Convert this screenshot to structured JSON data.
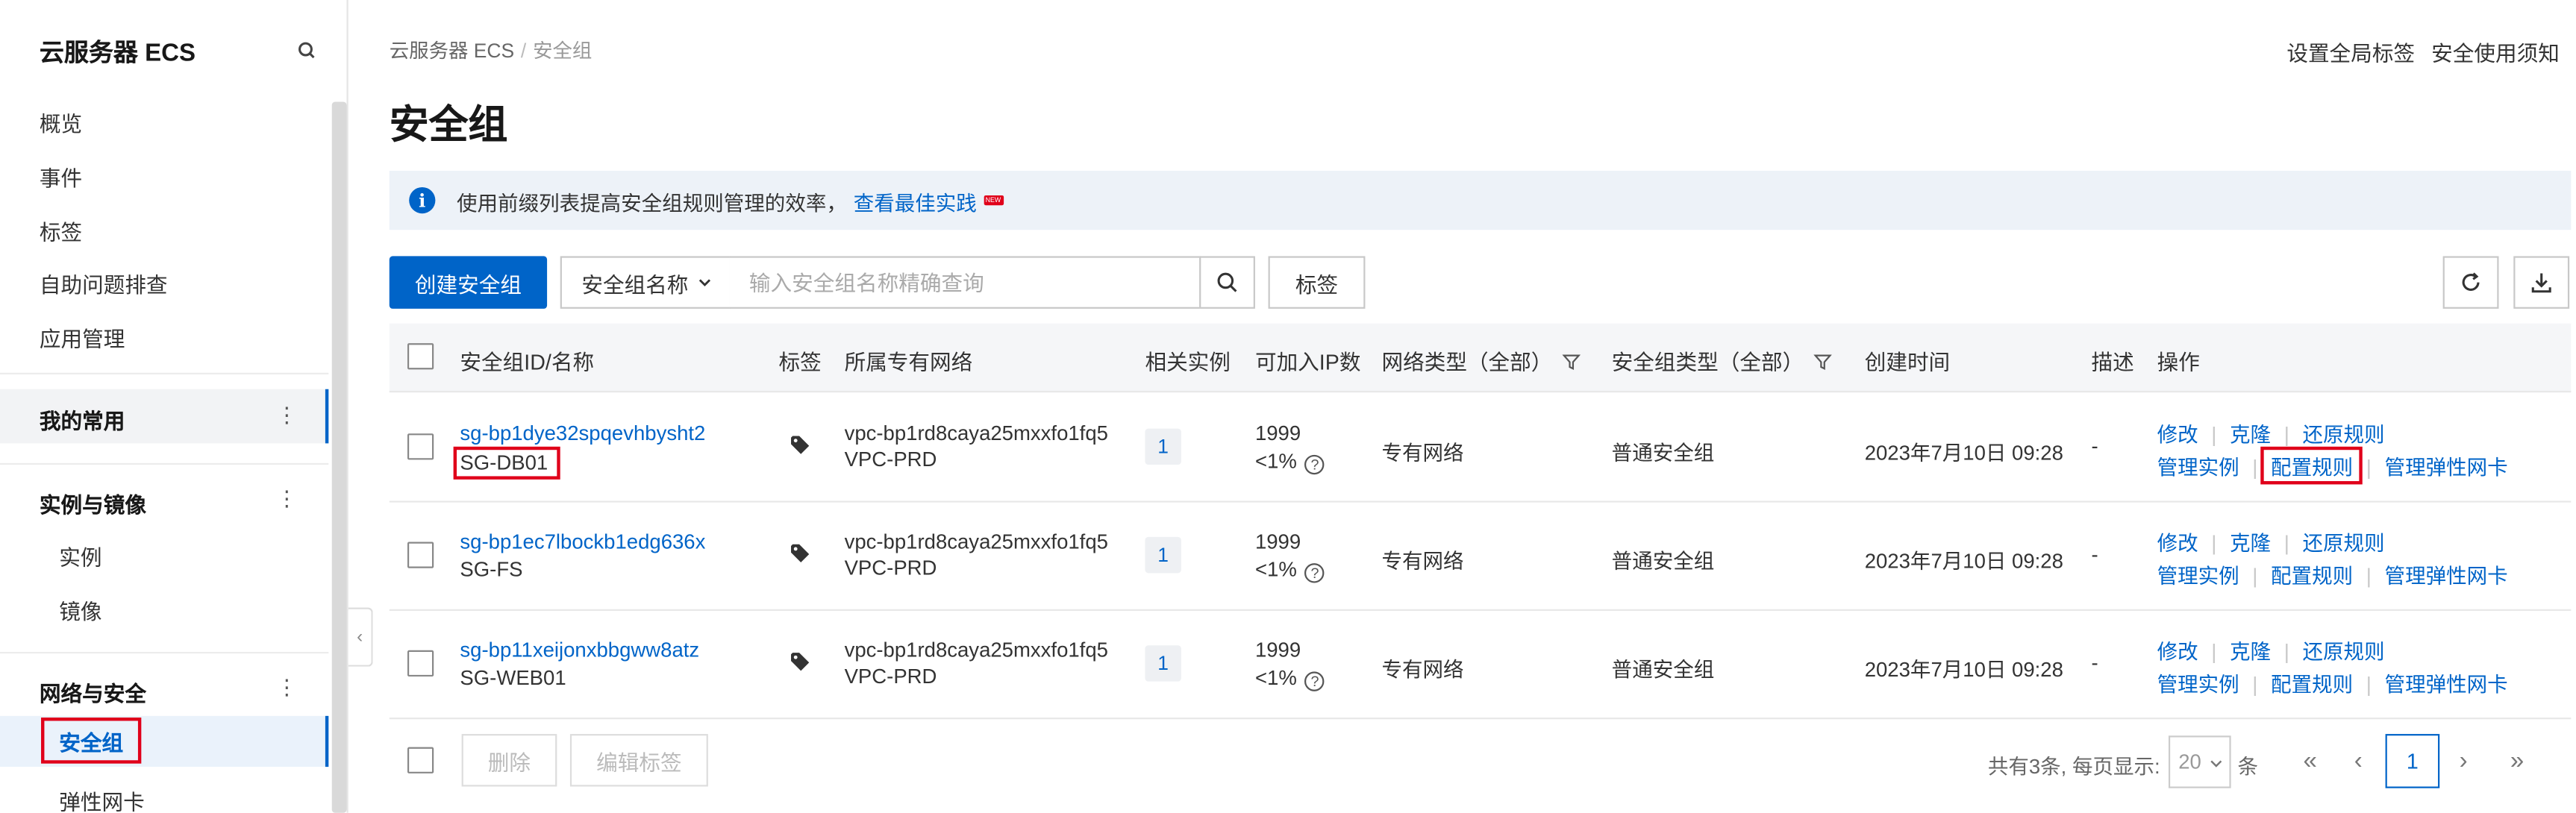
{
  "sidebar": {
    "title": "云服务器 ECS",
    "items": [
      "概览",
      "事件",
      "标签",
      "自助问题排查",
      "应用管理"
    ],
    "groups": {
      "favorites": "我的常用",
      "instances": {
        "label": "实例与镜像",
        "items": [
          "实例",
          "镜像"
        ]
      },
      "network": {
        "label": "网络与安全",
        "active": "安全组",
        "next": "弹性网卡"
      }
    }
  },
  "header": {
    "breadcrumb": [
      "云服务器 ECS",
      "/",
      "安全组"
    ],
    "title": "安全组",
    "links": [
      "设置全局标签",
      "安全使用须知"
    ]
  },
  "notice": {
    "text": "使用前缀列表提高安全组规则管理的效率，",
    "link": "查看最佳实践",
    "badge": "NEW"
  },
  "toolbar": {
    "create": "创建安全组",
    "filter_select": "安全组名称",
    "search_placeholder": "输入安全组名称精确查询",
    "tag_button": "标签"
  },
  "table": {
    "columns": [
      "安全组ID/名称",
      "标签",
      "所属专有网络",
      "相关实例",
      "可加入IP数",
      "网络类型（全部）",
      "安全组类型（全部）",
      "创建时间",
      "描述",
      "操作"
    ],
    "rows": [
      {
        "id": "sg-bp1dye32spqevhbysht2",
        "name": "SG-DB01",
        "vpc_id": "vpc-bp1rd8caya25mxxfo1fq5",
        "vpc_name": "VPC-PRD",
        "instances": "1",
        "ip_count": "1999",
        "ip_pct": "<1%",
        "net_type": "专有网络",
        "sg_type": "普通安全组",
        "created": "2023年7月10日 09:28",
        "desc": "-"
      },
      {
        "id": "sg-bp1ec7lbockb1edg636x",
        "name": "SG-FS",
        "vpc_id": "vpc-bp1rd8caya25mxxfo1fq5",
        "vpc_name": "VPC-PRD",
        "instances": "1",
        "ip_count": "1999",
        "ip_pct": "<1%",
        "net_type": "专有网络",
        "sg_type": "普通安全组",
        "created": "2023年7月10日 09:28",
        "desc": "-"
      },
      {
        "id": "sg-bp11xeijonxbbgww8atz",
        "name": "SG-WEB01",
        "vpc_id": "vpc-bp1rd8caya25mxxfo1fq5",
        "vpc_name": "VPC-PRD",
        "instances": "1",
        "ip_count": "1999",
        "ip_pct": "<1%",
        "net_type": "专有网络",
        "sg_type": "普通安全组",
        "created": "2023年7月10日 09:28",
        "desc": "-"
      }
    ],
    "ops": [
      "修改",
      "克隆",
      "还原规则",
      "管理实例",
      "配置规则",
      "管理弹性网卡"
    ],
    "ops_sep": "|"
  },
  "footer": {
    "delete": "删除",
    "edit_tags": "编辑标签",
    "total": "共有3条, 每页显示:",
    "page_size": "20",
    "unit": "条",
    "first": "«",
    "prev": "‹",
    "page": "1",
    "next": "›",
    "last": "»"
  },
  "icons": [
    "search-icon",
    "more-icon",
    "info-icon",
    "chevron-down-icon",
    "refresh-icon",
    "download-icon",
    "filter-icon",
    "tag-icon",
    "help-icon",
    "collapse-icon"
  ],
  "colors": {
    "primary": "#0064c8",
    "highlight": "#e0001a",
    "notice_bg": "#edf2f8",
    "header_bg": "#f5f6f8"
  }
}
